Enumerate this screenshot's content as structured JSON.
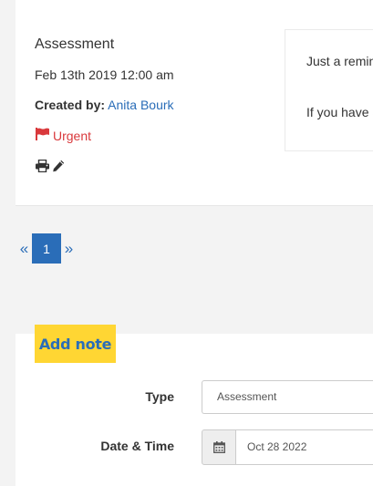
{
  "note": {
    "title": "Assessment",
    "date": "Feb 13th 2019 12:00 am",
    "created_label": "Created by:",
    "author": "Anita Bourk",
    "priority": "Urgent",
    "body_line1": "Just a remin",
    "body_line2": "If you have a"
  },
  "pagination": {
    "prev_symbol": "«",
    "current_page": "1",
    "next_symbol": "»"
  },
  "form": {
    "add_note_label": "Add note",
    "type_label": "Type",
    "type_value": "Assessment",
    "date_label": "Date & Time",
    "date_value": "Oct 28 2022"
  },
  "colors": {
    "accent_blue": "#2a6db8",
    "urgent_red": "#d9393c",
    "add_note_yellow": "#ffd633"
  },
  "icons": [
    "flag-icon",
    "print-icon",
    "pencil-icon",
    "calendar-icon"
  ]
}
